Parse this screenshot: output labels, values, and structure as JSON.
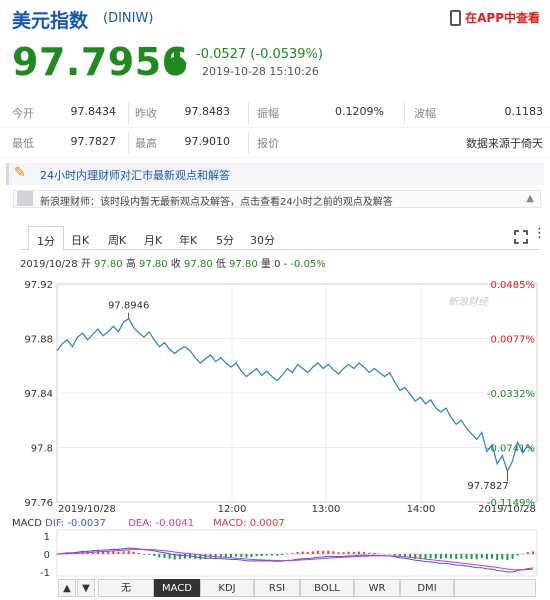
{
  "header": {
    "title": "美元指数",
    "code": "(DINIW)",
    "app_link": "在APP中查看"
  },
  "quote": {
    "price": "97.7956",
    "change": "-0.0527 (-0.0539%)",
    "time": "2019-10-28 15:10:26"
  },
  "stats": [
    [
      {
        "label": "今开",
        "value": "97.8434"
      },
      {
        "label": "昨收",
        "value": "97.8483"
      },
      {
        "label": "振幅",
        "value": "0.1209%"
      },
      {
        "label": "波幅",
        "value": "0.1183"
      }
    ],
    [
      {
        "label": "最低",
        "value": "97.7827"
      },
      {
        "label": "最高",
        "value": "97.9010"
      },
      {
        "label": "报价",
        "value": "数据来源于倚天"
      }
    ]
  ],
  "news": {
    "title": "24小时内理财师对汇市最新观点和解答",
    "comment": "新浪理财师：该时段内暂无最新观点及解答，点击查看24小时之前的观点及解答"
  },
  "tabs": [
    "1分",
    "日K",
    "周K",
    "月K",
    "年K",
    "5分",
    "30分"
  ],
  "bar_info": {
    "date": "2019/10/28",
    "open_l": "开",
    "open": "97.80",
    "high_l": "高",
    "high": "97.80",
    "close_l": "收",
    "close": "97.80",
    "low_l": "低",
    "low": "97.80",
    "vol_l": "量",
    "vol": "0",
    "pct": "-0.05%"
  },
  "watermark": "新浪财经",
  "indicators": [
    "无",
    "MACD",
    "KDJ",
    "RSI",
    "BOLL",
    "WR",
    "DMI"
  ],
  "nav": {
    "left": "▲",
    "right": "▼"
  },
  "macd": {
    "name": "MACD",
    "dif_label": "DIF:",
    "dif": "-0.0037",
    "dea_label": "DEA:",
    "dea": "-0.0041",
    "macd_label": "MACD:",
    "macd": "0.0007",
    "y_labels": [
      "1",
      "0",
      "-1"
    ],
    "colors": {
      "dif": "#3b5bdb",
      "dea": "#c03cd0",
      "macd": "#d04040",
      "up": "#e8433e",
      "down": "#1f9a4a"
    }
  },
  "chart_data": {
    "type": "line",
    "x_labels": [
      "2019/10/28",
      "12:00",
      "13:00",
      "14:00",
      "2019/10/28"
    ],
    "y_ticks": [
      "97.92",
      "97.88",
      "97.84",
      "97.8",
      "97.76"
    ],
    "pct_ticks": [
      "0.0485%",
      "0.0077%",
      "-0.0332%",
      "-0.0741%",
      "-0.1149%"
    ],
    "ylim": [
      97.76,
      97.92
    ],
    "annotations": [
      {
        "text": "97.8946",
        "value": 97.8946
      },
      {
        "text": "97.7827",
        "value": 97.7827
      }
    ],
    "line_color": "#2a7fc0",
    "series": [
      {
        "values": [
          97.871,
          97.876,
          97.879,
          97.874,
          97.881,
          97.884,
          97.879,
          97.883,
          97.887,
          97.882,
          97.885,
          97.889,
          97.885,
          97.892,
          97.8946,
          97.888,
          97.884,
          97.881,
          97.885,
          97.879,
          97.874,
          97.877,
          97.872,
          97.869,
          97.872,
          97.874,
          97.871,
          97.866,
          97.862,
          97.865,
          97.868,
          97.863,
          97.866,
          97.862,
          97.859,
          97.862,
          97.856,
          97.852,
          97.855,
          97.858,
          97.853,
          97.856,
          97.852,
          97.849,
          97.853,
          97.858,
          97.855,
          97.861,
          97.858,
          97.855,
          97.859,
          97.862,
          97.858,
          97.861,
          97.857,
          97.854,
          97.858,
          97.861,
          97.858,
          97.862,
          97.859,
          97.855,
          97.858,
          97.855,
          97.852,
          97.855,
          97.848,
          97.842,
          97.844,
          97.839,
          97.834,
          97.837,
          97.832,
          97.835,
          97.829,
          97.826,
          97.829,
          97.822,
          97.817,
          97.82,
          97.814,
          97.81,
          97.806,
          97.811,
          97.797,
          97.802,
          97.788,
          97.794,
          97.7827,
          97.79,
          97.804,
          97.796,
          97.802,
          97.797
        ]
      }
    ]
  }
}
